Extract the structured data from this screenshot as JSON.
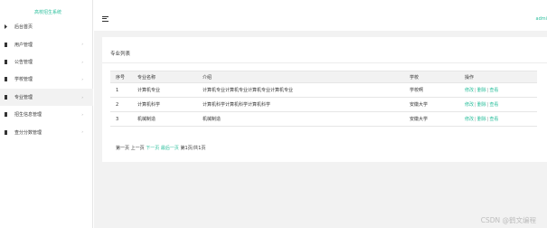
{
  "sidebar": {
    "brand": "高校招生系统",
    "items": [
      {
        "label": "后台首页",
        "icon": "home-icon",
        "has_caret": false,
        "active": false
      },
      {
        "label": "用户管理",
        "icon": "square-icon",
        "has_caret": true,
        "active": false
      },
      {
        "label": "公告管理",
        "icon": "square-icon",
        "has_caret": true,
        "active": false
      },
      {
        "label": "学校管理",
        "icon": "square-icon",
        "has_caret": true,
        "active": false
      },
      {
        "label": "专业管理",
        "icon": "square-icon",
        "has_caret": true,
        "active": true
      },
      {
        "label": "招生信息管理",
        "icon": "square-icon",
        "has_caret": true,
        "active": false
      },
      {
        "label": "查分分数管理",
        "icon": "square-icon",
        "has_caret": true,
        "active": false
      }
    ]
  },
  "header": {
    "user": "admi"
  },
  "main": {
    "title": "专业列表",
    "table": {
      "columns": [
        "序号",
        "专业名称",
        "介绍",
        "学校",
        "操作"
      ],
      "rows": [
        {
          "no": "1",
          "name": "计算机专业",
          "intro": "计算机专业计算机专业计算机专业计算机专业",
          "school": "学校啊",
          "actions": [
            "修改",
            "删除",
            "查看"
          ]
        },
        {
          "no": "2",
          "name": "计算机科学",
          "intro": "计算机科学计算机科学计算机科学",
          "school": "安徽大学",
          "actions": [
            "修改",
            "删除",
            "查看"
          ]
        },
        {
          "no": "3",
          "name": "机械制造",
          "intro": "机械制造",
          "school": "安徽大学",
          "actions": [
            "修改",
            "删除",
            "查看"
          ]
        }
      ]
    },
    "pager": {
      "first": "第一页",
      "prev": "上一页",
      "next": "下一页",
      "last": "最后一页",
      "status": "第1页/共1页"
    }
  },
  "watermark": "CSDN @鹤文编程",
  "colors": {
    "accent": "#2bbf9c",
    "background": "#f2f2f2",
    "header_row": "#f2f2f2"
  }
}
